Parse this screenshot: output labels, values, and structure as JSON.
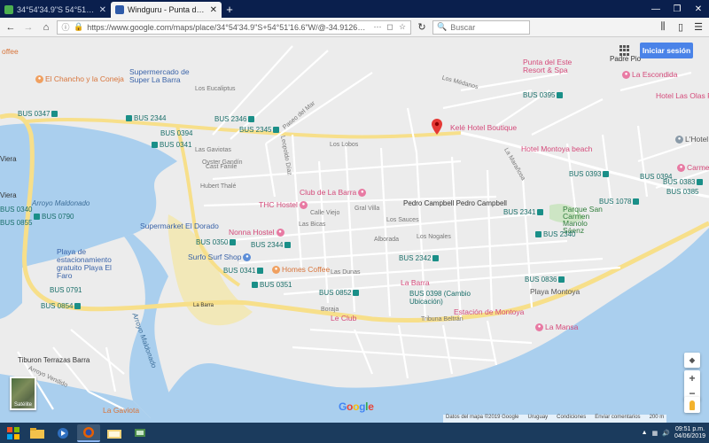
{
  "browser": {
    "tabs": [
      {
        "title": "34°54'34.9\"S 54°51'16.6\"W - G",
        "favicon_color": "#4caf50",
        "active": false
      },
      {
        "title": "Windguru - Punta del Este - Pl",
        "favicon_color": "#2e5aa8",
        "active": true
      }
    ],
    "new_tab_label": "+",
    "window_controls": [
      "—",
      "❐",
      "✕"
    ],
    "url": "https://www.google.com/maps/place/34°54'34.9\"S+54°51'16.6\"W/@-34.9126793,-54",
    "search_placeholder": "Buscar"
  },
  "map": {
    "sign_in_label": "Iniciar sesión",
    "google_label": "Google",
    "satellite_label": "Satélite",
    "zoom_in": "+",
    "zoom_out": "−",
    "footer": [
      "Datos del mapa ©2019 Google",
      "Uruguay",
      "Condiciones",
      "Enviar comentarios",
      "200 m"
    ],
    "places": {
      "coffee": "offee",
      "chancho": "El Chancho y la Coneja",
      "supermercado": "Supermercado de Super La Barra",
      "punta_resort": "Punta del Este Resort & Spa",
      "la_escondida": "La Escondida",
      "padre_pio": "Padre Pio",
      "hotel_olas": "Hotel Las Olas Re",
      "kele": "Kelé Hotel Boutique",
      "l_hotel": "L'Hotel de",
      "montoya_beach": "Hotel Montoya beach",
      "carmen": "Carmen",
      "club_barra": "Club de La Barra",
      "thc_hostel": "THC Hostel",
      "pedro": "Pedro Campbell  Pedro Campbell",
      "parque": "Parque San Carmen Manolo Sáenz",
      "super_dorado": "Supermarket El Dorado",
      "nonna": "Nonna Hostel",
      "surfo": "Surfo Surf Shop",
      "homes_coffee": "Homes Coffee",
      "la_barra_dot": "La Barra",
      "playa_est": "Playa de estacionamiento gratuito Playa El Faro",
      "playa_montoya": "Playa Montoya",
      "le_club": "Le Club",
      "estacion_montoya": "Estación de Montoya",
      "la_mansa": "La Mansa",
      "tiburon": "Tiburon Terrazas Barra",
      "la_gaviota": "La Gaviota",
      "arroyo": "Arroyo Maldonado",
      "arroyo2": "Arroyo Maldonado",
      "viera": "Viera",
      "la_barra": "La Barra",
      "l_hotel2": "L'Hotel"
    },
    "bus_stops": {
      "b0347": "BUS 0347",
      "b2344a": "BUS 2344",
      "b2346": "BUS 2346",
      "b2345": "BUS 2345",
      "b0394": "BUS 0394",
      "b0341": "BUS 0341",
      "b0395": "BUS 0395",
      "b0790": "BUS 0790",
      "b0855": "BUS 0855",
      "b0350": "BUS 0350",
      "b2344b": "BUS 2344",
      "b2342": "BUS 2342",
      "b0341b": "BUS 0341",
      "b0351": "BUS 0351",
      "b0852": "BUS 0852",
      "b0398": "BUS 0398 (Cambio Ubicación)",
      "b0836": "BUS 0836",
      "b0854": "BUS 0854",
      "b0791": "BUS 0791",
      "b0393": "BUS 0393",
      "b0394b": "BUS 0394",
      "b2341": "BUS 2341",
      "b1078": "BUS 1078",
      "b2340": "BUS 2340",
      "b0383": "BUS 0383",
      "b0385": "BUS 0385",
      "b0340": "BUS 0340"
    },
    "streets": {
      "s1": "Los Eucaliptus",
      "s2": "Los Médanos",
      "s3": "Paseo del Mar",
      "s4": "Oyster Gandín",
      "s5": "Las Gaviotas",
      "s6": "Cast Fanile",
      "s7": "Hubert Thalé",
      "s8": "Leopoldo Díaz",
      "s9": "Los Lobos",
      "s10": "Calle Viejo",
      "s11": "Las Dunas",
      "s12": "La Marañosa",
      "s13": "Tribuna Beltrán",
      "s14": "Alborada",
      "s15": "Las Bicas",
      "s16": "Los Sauces",
      "s17": "Boraja",
      "s18": "Los Nogales",
      "s19": "Gral Villa",
      "s20": "Arroyo Vendido"
    }
  },
  "taskbar": {
    "time": "09:51 p.m.",
    "date": "04/06/2019"
  }
}
